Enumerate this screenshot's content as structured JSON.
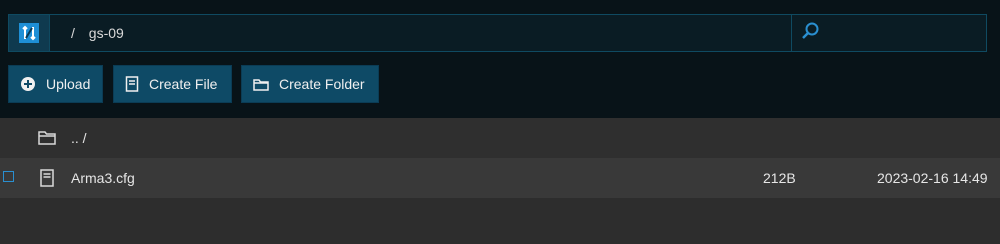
{
  "header": {
    "path_separator": "/",
    "path_current": "gs-09",
    "search_placeholder": ""
  },
  "toolbar": {
    "upload_label": "Upload",
    "create_file_label": "Create File",
    "create_folder_label": "Create Folder"
  },
  "listing": {
    "parent_label": ".. /",
    "files": [
      {
        "name": "Arma3.cfg",
        "size": "212B",
        "modified": "2023-02-16 14:49"
      }
    ]
  },
  "colors": {
    "accent": "#2a8fd0",
    "button_bg": "#0e4a66",
    "header_bg": "#081318"
  },
  "icons": {
    "logo": "refresh-logo-icon",
    "search": "search-icon",
    "upload": "plus-circle-icon",
    "file": "file-icon",
    "folder": "folder-icon"
  }
}
